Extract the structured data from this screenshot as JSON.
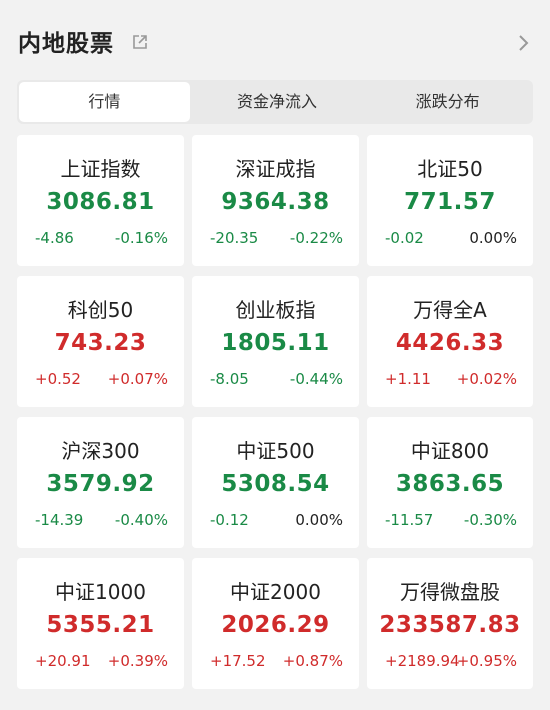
{
  "header": {
    "title": "内地股票"
  },
  "tabs": [
    {
      "label": "行情",
      "active": true
    },
    {
      "label": "资金净流入",
      "active": false
    },
    {
      "label": "涨跌分布",
      "active": false
    }
  ],
  "colors": {
    "up": "#d02b2b",
    "down": "#1a8a46",
    "flat": "#222222"
  },
  "indices": [
    {
      "name": "上证指数",
      "value": "3086.81",
      "change": "-4.86",
      "pct": "-0.16%",
      "trend": "down"
    },
    {
      "name": "深证成指",
      "value": "9364.38",
      "change": "-20.35",
      "pct": "-0.22%",
      "trend": "down"
    },
    {
      "name": "北证50",
      "value": "771.57",
      "change": "-0.02",
      "pct": "0.00%",
      "trend": "down",
      "pct_trend": "flat"
    },
    {
      "name": "科创50",
      "value": "743.23",
      "change": "+0.52",
      "pct": "+0.07%",
      "trend": "up"
    },
    {
      "name": "创业板指",
      "value": "1805.11",
      "change": "-8.05",
      "pct": "-0.44%",
      "trend": "down"
    },
    {
      "name": "万得全A",
      "value": "4426.33",
      "change": "+1.11",
      "pct": "+0.02%",
      "trend": "up"
    },
    {
      "name": "沪深300",
      "value": "3579.92",
      "change": "-14.39",
      "pct": "-0.40%",
      "trend": "down"
    },
    {
      "name": "中证500",
      "value": "5308.54",
      "change": "-0.12",
      "pct": "0.00%",
      "trend": "down",
      "pct_trend": "flat"
    },
    {
      "name": "中证800",
      "value": "3863.65",
      "change": "-11.57",
      "pct": "-0.30%",
      "trend": "down"
    },
    {
      "name": "中证1000",
      "value": "5355.21",
      "change": "+20.91",
      "pct": "+0.39%",
      "trend": "up"
    },
    {
      "name": "中证2000",
      "value": "2026.29",
      "change": "+17.52",
      "pct": "+0.87%",
      "trend": "up"
    },
    {
      "name": "万得微盘股",
      "value": "233587.83",
      "change": "+2189.94",
      "pct": "+0.95%",
      "trend": "up"
    }
  ]
}
